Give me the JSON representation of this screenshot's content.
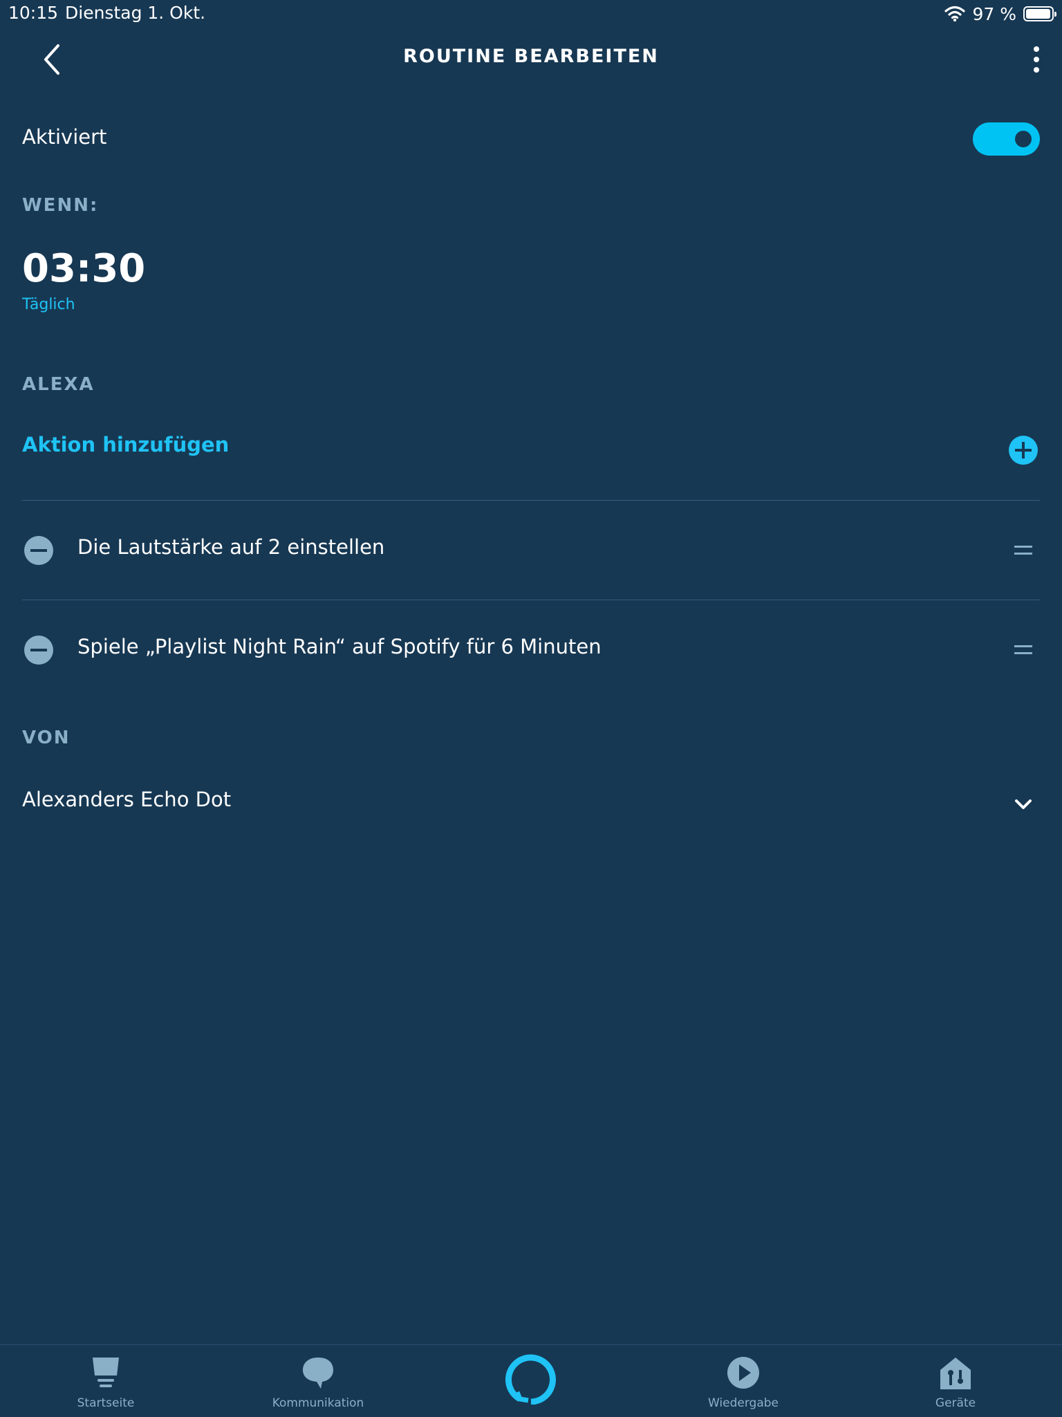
{
  "status_bar": {
    "time": "10:15",
    "date": "Dienstag 1. Okt.",
    "battery_percent_text": "97 %",
    "battery_level": 0.97,
    "icons": [
      "wifi-icon",
      "battery-icon"
    ]
  },
  "header": {
    "title": "ROUTINE BEARBEITEN",
    "back_icon": "chevron-left-icon",
    "more_icon": "more-vertical-icon"
  },
  "enabled": {
    "label": "Aktiviert",
    "value": true,
    "accent_color": "#00c3f3"
  },
  "when": {
    "section_label": "WENN:",
    "time": "03:30",
    "frequency": "Täglich"
  },
  "alexa": {
    "section_label": "ALEXA",
    "add_action_label": "Aktion hinzufügen",
    "actions": [
      {
        "text": "Die Lautstärke auf 2 einstellen"
      },
      {
        "text": "Spiele „Playlist Night Rain“ auf Spotify für 6 Minuten"
      }
    ]
  },
  "from": {
    "section_label": "VON",
    "device": "Alexanders Echo Dot"
  },
  "bottom_nav": {
    "items": [
      {
        "label": "Startseite",
        "icon": "home-icon"
      },
      {
        "label": "Kommunikation",
        "icon": "chat-bubble-icon"
      },
      {
        "label": "Wiedergabe",
        "icon": "play-icon"
      },
      {
        "label": "Geräte",
        "icon": "devices-icon"
      }
    ],
    "center_icon": "alexa-icon"
  },
  "colors": {
    "background": "#173853",
    "accent": "#1fc3f5",
    "muted": "#8ab0c7"
  }
}
